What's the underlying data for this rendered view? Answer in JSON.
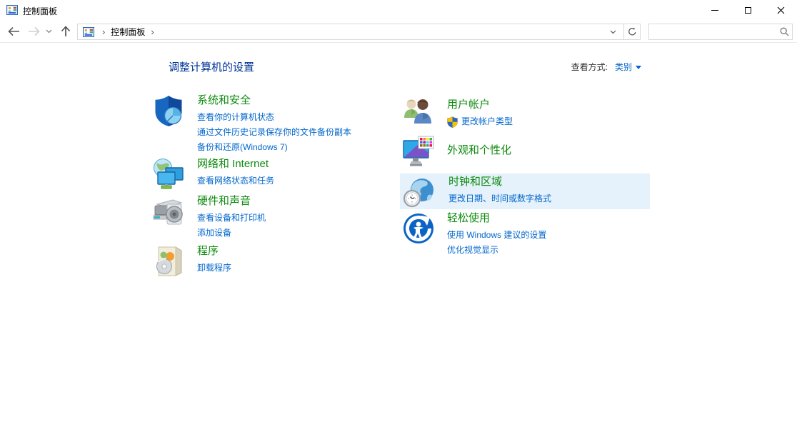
{
  "window": {
    "title": "控制面板"
  },
  "toolbar": {
    "breadcrumb_root": "控制面板",
    "search_value": "",
    "search_placeholder": ""
  },
  "header": {
    "title": "调整计算机的设置",
    "view_by_label": "查看方式:",
    "view_by_value": "类别"
  },
  "categories": {
    "left": [
      {
        "title": "系统和安全",
        "icon": "security-shield-icon",
        "links": [
          "查看你的计算机状态",
          "通过文件历史记录保存你的文件备份副本",
          "备份和还原(Windows 7)"
        ]
      },
      {
        "title": "网络和 Internet",
        "icon": "network-globe-monitors-icon",
        "links": [
          "查看网络状态和任务"
        ]
      },
      {
        "title": "硬件和声音",
        "icon": "printer-speaker-icon",
        "links": [
          "查看设备和打印机",
          "添加设备"
        ]
      },
      {
        "title": "程序",
        "icon": "software-box-cd-icon",
        "links": [
          "卸载程序"
        ]
      }
    ],
    "right": [
      {
        "title": "用户帐户",
        "icon": "two-users-icon",
        "links": [
          "更改帐户类型"
        ]
      },
      {
        "title": "外观和个性化",
        "icon": "monitor-palette-icon",
        "links": []
      },
      {
        "title": "时钟和区域",
        "icon": "globe-clock-icon",
        "highlighted": true,
        "links": [
          "更改日期、时间或数字格式"
        ]
      },
      {
        "title": "轻松使用",
        "icon": "ease-of-access-icon",
        "links": [
          "使用 Windows 建议的设置",
          "优化视觉显示"
        ]
      }
    ]
  },
  "colors": {
    "category_title_green": "#0c8a0c",
    "link_blue": "#0066cc",
    "page_title_navy": "#003399",
    "hover_highlight": "#e5f1fb"
  }
}
